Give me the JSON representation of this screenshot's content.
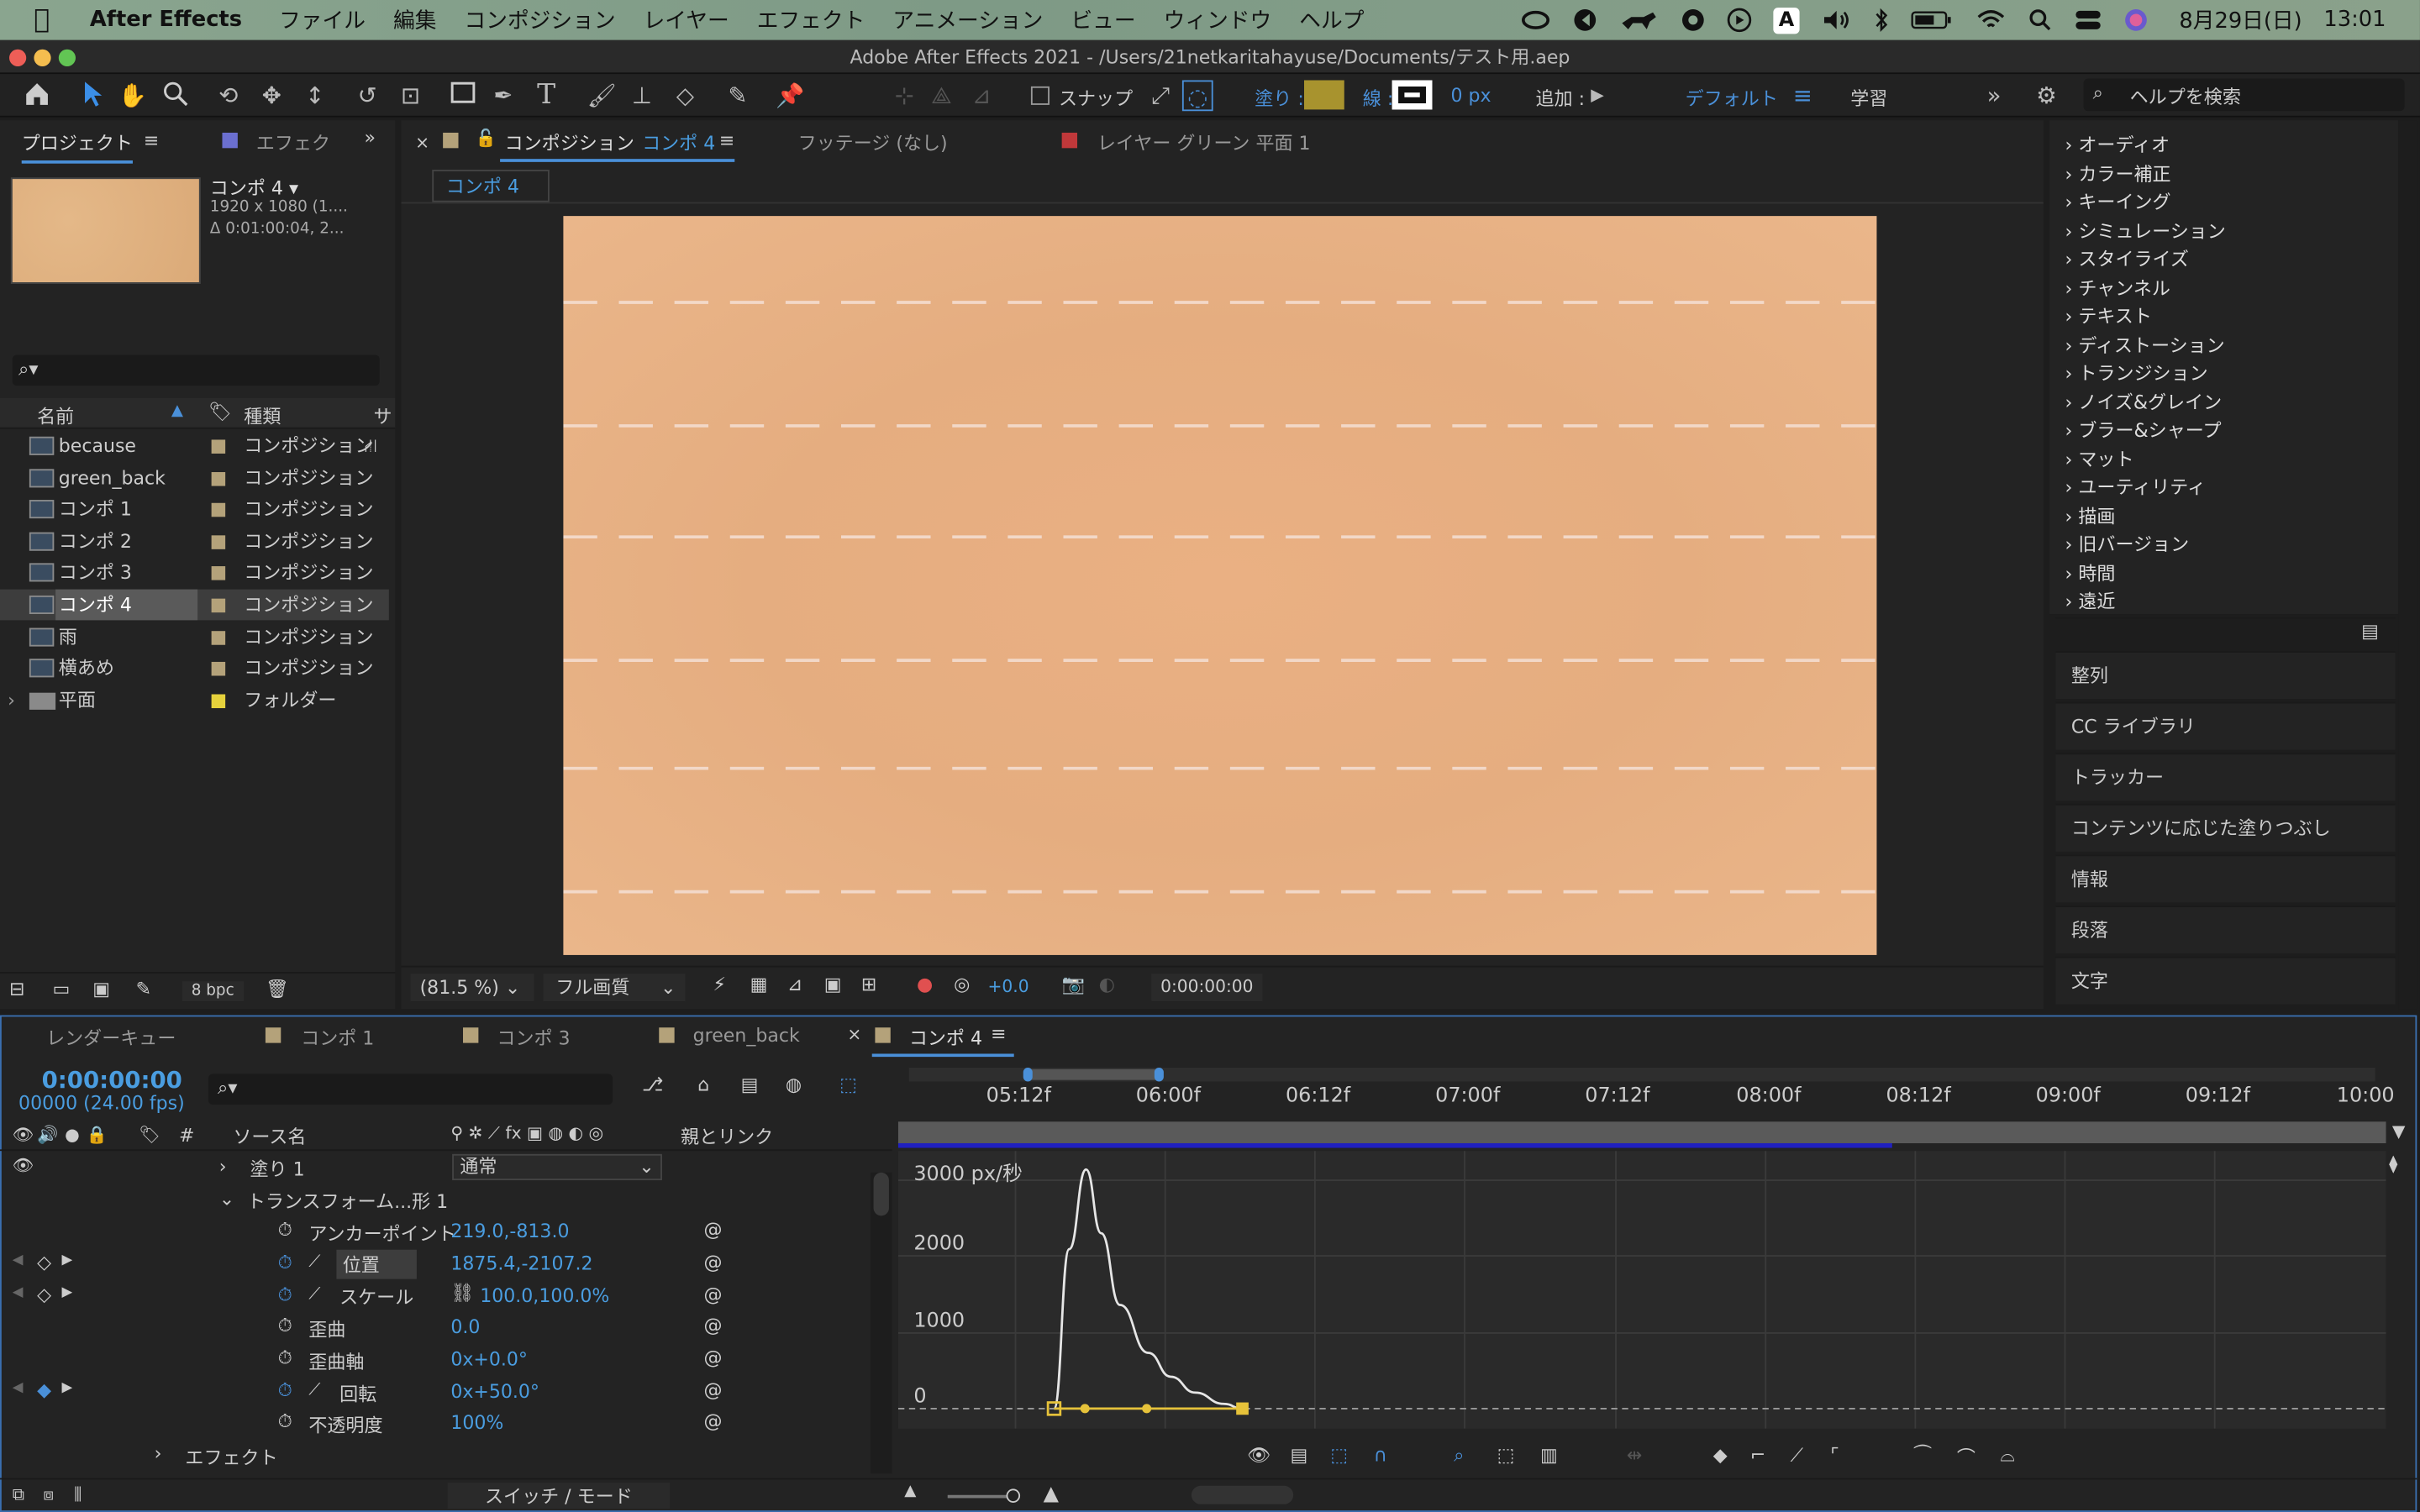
{
  "menubar": {
    "app_name": "After Effects",
    "items": [
      "ファイル",
      "編集",
      "コンポジション",
      "レイヤー",
      "エフェクト",
      "アニメーション",
      "ビュー",
      "ウィンドウ",
      "ヘルプ"
    ],
    "date": "8月29日(日)",
    "time": "13:01",
    "input_indicator": "A"
  },
  "window": {
    "title": "Adobe After Effects 2021 - /Users/21netkaritahayuse/Documents/テスト用.aep"
  },
  "toolbar": {
    "snap_label": "スナップ",
    "fill_label": "塗り :",
    "stroke_label": "線 :",
    "stroke_width": "0 px",
    "add_label": "追加 :",
    "workspace_default": "デフォルト",
    "workspace_learn": "学習",
    "help_search_placeholder": "ヘルプを検索",
    "fill_color": "#a8932e"
  },
  "project_panel": {
    "tab_project": "プロジェクト",
    "tab_effects": "エフェク",
    "selected_name": "コンポ 4 ▾",
    "selected_dims": "1920 x 1080 (1....",
    "selected_duration": "Δ 0:01:00:04, 2...",
    "col_name": "名前",
    "col_type": "種類",
    "col_extra": "サ",
    "bpc": "8 bpc",
    "items": [
      {
        "name": "because",
        "type": "コンポジション"
      },
      {
        "name": "green_back",
        "type": "コンポジション"
      },
      {
        "name": "コンポ 1",
        "type": "コンポジション"
      },
      {
        "name": "コンポ 2",
        "type": "コンポジション"
      },
      {
        "name": "コンポ 3",
        "type": "コンポジション"
      },
      {
        "name": "コンポ 4",
        "type": "コンポジション"
      },
      {
        "name": "雨",
        "type": "コンポジション"
      },
      {
        "name": "横あめ",
        "type": "コンポジション"
      },
      {
        "name": "平面",
        "type": "フォルダー"
      }
    ]
  },
  "viewer": {
    "tab_comp_prefix": "コンポジション",
    "tab_comp_name": "コンポ 4",
    "tab_footage": "フッテージ (なし)",
    "tab_layer": "レイヤー グリーン 平面 1",
    "breadcrumb": "コンポ 4",
    "zoom": "(81.5 %)",
    "quality": "フル画質",
    "exposure": "+0.0",
    "timecode": "0:00:00:00"
  },
  "effects_list": [
    "オーディオ",
    "カラー補正",
    "キーイング",
    "シミュレーション",
    "スタイライズ",
    "チャンネル",
    "テキスト",
    "ディストーション",
    "トランジション",
    "ノイズ&グレイン",
    "ブラー&シャープ",
    "マット",
    "ユーティリティ",
    "描画",
    "旧バージョン",
    "時間",
    "遠近"
  ],
  "right_panels": [
    "整列",
    "CC ライブラリ",
    "トラッカー",
    "コンテンツに応じた塗りつぶし",
    "情報",
    "段落",
    "文字"
  ],
  "timeline": {
    "tabs": [
      "レンダーキュー",
      "コンポ 1",
      "コンポ 3",
      "green_back",
      "コンポ 4"
    ],
    "current_time": "0:00:00:00",
    "frame_info": "00000 (24.00 fps)",
    "col_source": "ソース名",
    "col_parent": "親とリンク",
    "col_hash": "#",
    "switch_mode": "スイッチ / モード",
    "fill_row": "塗り 1",
    "blend_mode": "通常",
    "transform_group": "トランスフォーム...形 1",
    "effect_group": "エフェクト",
    "properties": [
      {
        "name": "アンカーポイント",
        "value": "219.0,-813.0"
      },
      {
        "name": "位置",
        "value": "1875.4,-2107.2"
      },
      {
        "name": "スケール",
        "value": "100.0,100.0%"
      },
      {
        "name": "歪曲",
        "value": "0.0"
      },
      {
        "name": "歪曲軸",
        "value": "0x+0.0°"
      },
      {
        "name": "回転",
        "value": "0x+50.0°"
      },
      {
        "name": "不透明度",
        "value": "100%"
      }
    ],
    "ruler_ticks": [
      "05:12f",
      "06:00f",
      "06:12f",
      "07:00f",
      "07:12f",
      "08:00f",
      "08:12f",
      "09:00f",
      "09:12f",
      "10:00"
    ]
  },
  "chart_data": {
    "type": "line",
    "ylabel": "3000 px/秒",
    "y_ticks": [
      "2000",
      "1000",
      "0"
    ],
    "ylim": [
      0,
      3000
    ],
    "series": [
      {
        "x": [
          0,
          0.08,
          0.17,
          0.25,
          0.35,
          0.5,
          0.62,
          0.75,
          0.9,
          1.0
        ],
        "values": [
          0,
          2000,
          3000,
          2200,
          1300,
          700,
          400,
          200,
          60,
          0
        ]
      }
    ]
  }
}
